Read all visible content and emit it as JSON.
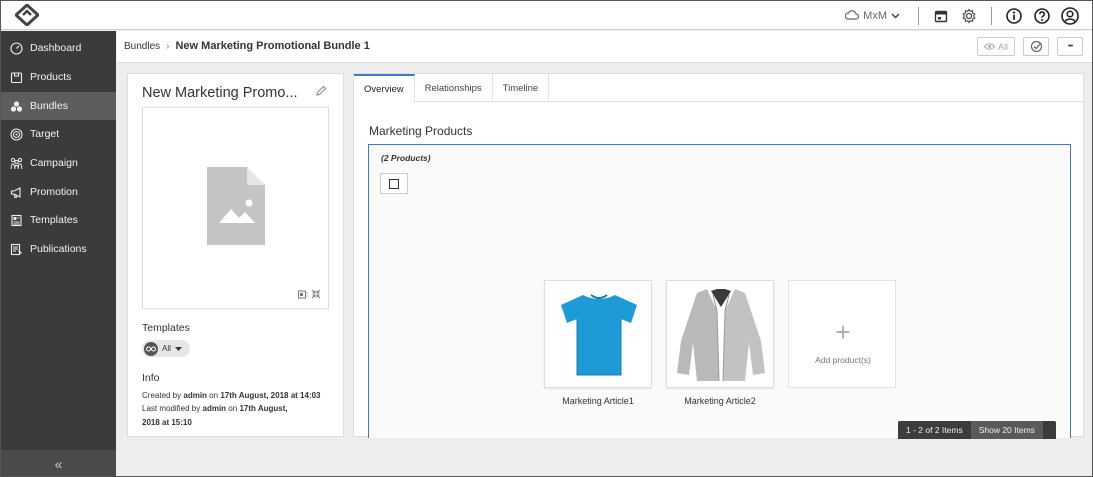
{
  "topbar": {
    "logo_icon": "logo-icon",
    "context_label": "MxM",
    "icons": [
      "cloud-icon",
      "chevron-down-icon",
      "calendar-icon",
      "gear-icon",
      "info-icon",
      "help-icon",
      "user-icon"
    ]
  },
  "sidebar": {
    "items": [
      {
        "label": "Dashboard",
        "icon": "dashboard-icon"
      },
      {
        "label": "Products",
        "icon": "products-icon"
      },
      {
        "label": "Bundles",
        "icon": "bundles-icon",
        "active": true
      },
      {
        "label": "Target",
        "icon": "target-icon"
      },
      {
        "label": "Campaign",
        "icon": "campaign-icon"
      },
      {
        "label": "Promotion",
        "icon": "promotion-icon"
      },
      {
        "label": "Templates",
        "icon": "templates-icon"
      },
      {
        "label": "Publications",
        "icon": "publications-icon"
      }
    ],
    "collapse_label": "«"
  },
  "header": {
    "breadcrumb_root": "Bundles",
    "breadcrumb_sep": "›",
    "breadcrumb_current": "New Marketing Promotional Bundle 1",
    "view_all_label": "All",
    "more_label": "•••"
  },
  "left_panel": {
    "title": "New Marketing Promo...",
    "templates_label": "Templates",
    "templates_filter": "All",
    "info_label": "Info",
    "created_prefix": "Created by",
    "created_by": "admin",
    "created_on_word": "on",
    "created_date": "17th August, 2018 at 14:03",
    "modified_prefix": "Last modified by",
    "modified_by": "admin",
    "modified_on_word": "on",
    "modified_date_part1": "17th August,",
    "modified_date_part2": "2018 at 15:10"
  },
  "tabs": [
    {
      "label": "Overview",
      "active": true
    },
    {
      "label": "Relationships"
    },
    {
      "label": "Timeline"
    }
  ],
  "marketing_products": {
    "section_title": "Marketing Products",
    "count_label": "(2 Products)",
    "products": [
      {
        "name": "Marketing Article1",
        "image": "blue-tshirt"
      },
      {
        "name": "Marketing Article2",
        "image": "grey-cardigan"
      }
    ],
    "add_label": "Add product(s)",
    "add_symbol": "+",
    "pager_count": "1 - 2 of 2 Items",
    "pager_show": "Show 20 Items"
  },
  "colors": {
    "sidebar_bg": "#3b3b3b",
    "sidebar_active": "#5d5d5d",
    "accent": "#3a78c9",
    "tshirt": "#1e9ad6",
    "cardigan": "#b9b9b9"
  }
}
